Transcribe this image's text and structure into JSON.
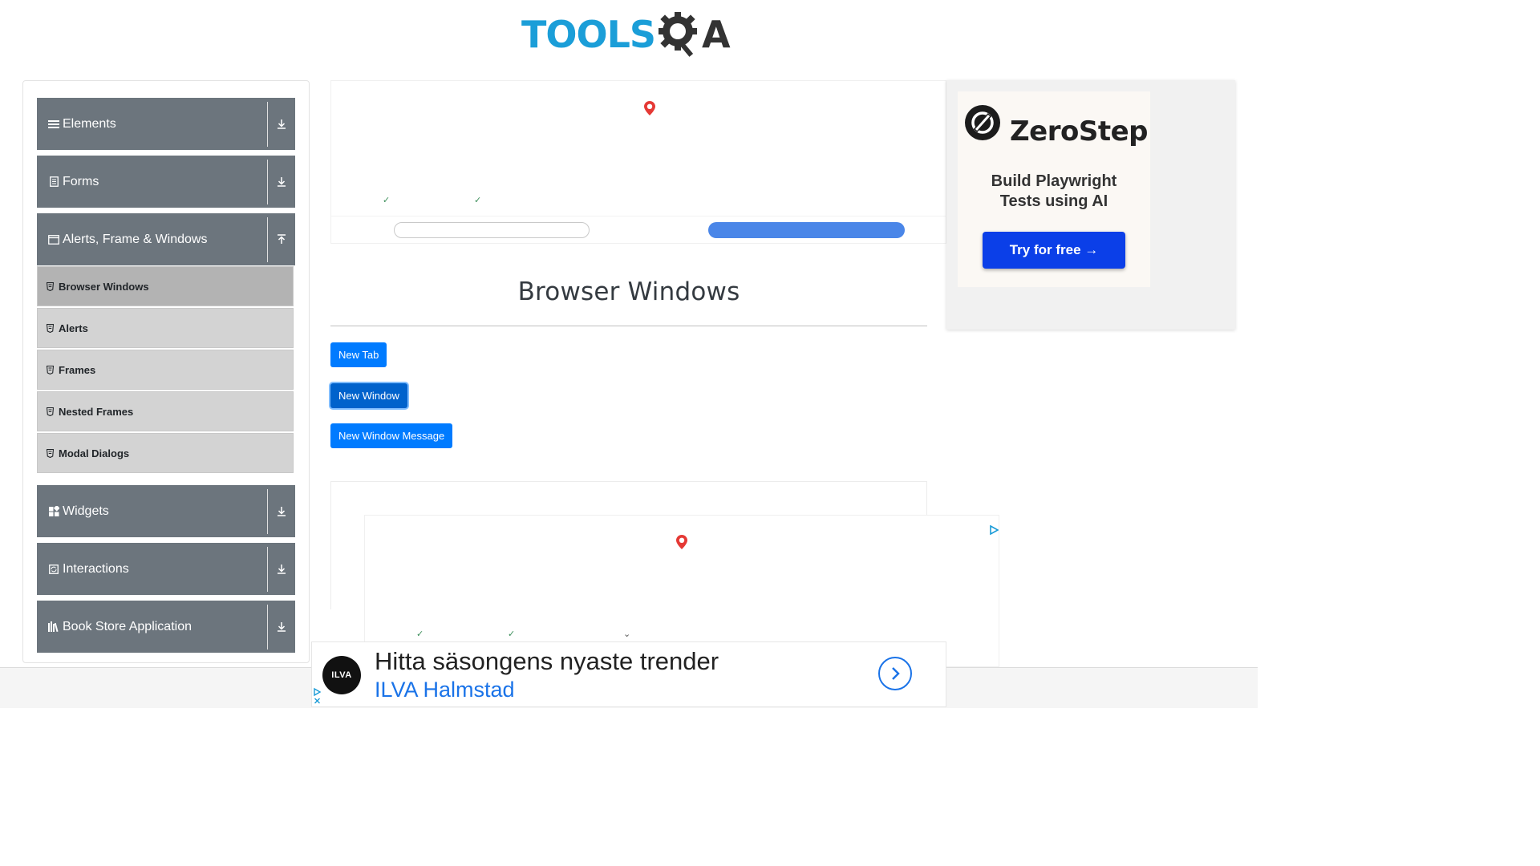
{
  "header": {
    "logo_part1": "TOOLS",
    "logo_part2": "QA"
  },
  "sidebar": {
    "groups": [
      {
        "label": "Elements",
        "icon": "hamburger-icon",
        "arrow": "download-arrow-icon"
      },
      {
        "label": "Forms",
        "icon": "form-icon",
        "arrow": "download-arrow-icon"
      },
      {
        "label": "Alerts, Frame & Windows",
        "icon": "window-icon",
        "arrow": "upload-arrow-icon"
      },
      {
        "label": "Widgets",
        "icon": "widgets-icon",
        "arrow": "download-arrow-icon"
      },
      {
        "label": "Interactions",
        "icon": "interactions-icon",
        "arrow": "download-arrow-icon"
      },
      {
        "label": "Book Store Application",
        "icon": "library-icon",
        "arrow": "download-arrow-icon"
      }
    ],
    "sub_items": [
      {
        "label": "Browser Windows",
        "active": true
      },
      {
        "label": "Alerts"
      },
      {
        "label": "Frames"
      },
      {
        "label": "Nested Frames"
      },
      {
        "label": "Modal Dialogs"
      }
    ]
  },
  "main": {
    "title": "Browser Windows",
    "buttons": {
      "new_tab": "New Tab",
      "new_window": "New Window",
      "new_window_message": "New Window Message"
    }
  },
  "right_ad": {
    "brand": "ZeroStep",
    "tagline_line1": "Build Playwright",
    "tagline_line2": "Tests using AI",
    "cta": "Try for free →"
  },
  "bottom_banner": {
    "logo_text": "ILVA",
    "headline": "Hitta säsongens nyaste trender",
    "sub": "ILVA Halmstad"
  },
  "colors": {
    "accent": "#007bff",
    "sidebar_header": "#6c757d",
    "sub_item": "#d3d3d3",
    "logo_blue": "#1b9ed8",
    "ad_cta": "#0b3fe8"
  }
}
